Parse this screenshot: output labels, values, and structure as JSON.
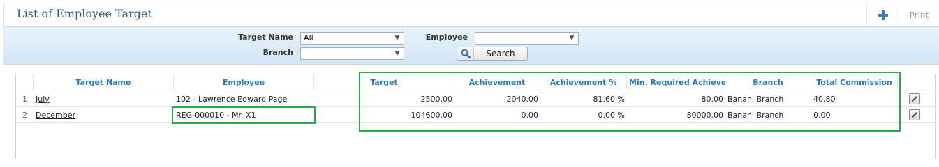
{
  "header": {
    "title": "List of Employee Target",
    "print_label": "Print",
    "add_icon": "plus-icon"
  },
  "filters": {
    "target_name_label": "Target Name",
    "target_name_value": "All",
    "employee_label": "Employee",
    "employee_value": "",
    "branch_label": "Branch",
    "branch_value": "",
    "search_label": "Search",
    "search_icon": "search-icon"
  },
  "grid": {
    "columns": [
      "Target Name",
      "Employee",
      "Target",
      "Achievement",
      "Achievement %",
      "Min. Required Achievem",
      "Branch",
      "Total Commission"
    ],
    "rows": [
      {
        "num": "1",
        "target_name": "July",
        "employee": "102 - Lawrence Edward Page",
        "target": "2500.00",
        "achievement": "2040.00",
        "achievement_pct": "81.60 %",
        "min_required": "80.00",
        "branch": "Banani Branch",
        "total_commission": "40.80"
      },
      {
        "num": "2",
        "target_name": "December",
        "employee": "REG-000010 - Mr. X1",
        "target": "104600.00",
        "achievement": "0.00",
        "achievement_pct": "0.00 %",
        "min_required": "80000.00",
        "branch": "Banani Branch",
        "total_commission": "0.00"
      }
    ],
    "edit_icon": "pencil-icon"
  },
  "colors": {
    "title": "#2b5a8a",
    "column_header": "#2a79c4",
    "highlight": "#2aa84a"
  }
}
